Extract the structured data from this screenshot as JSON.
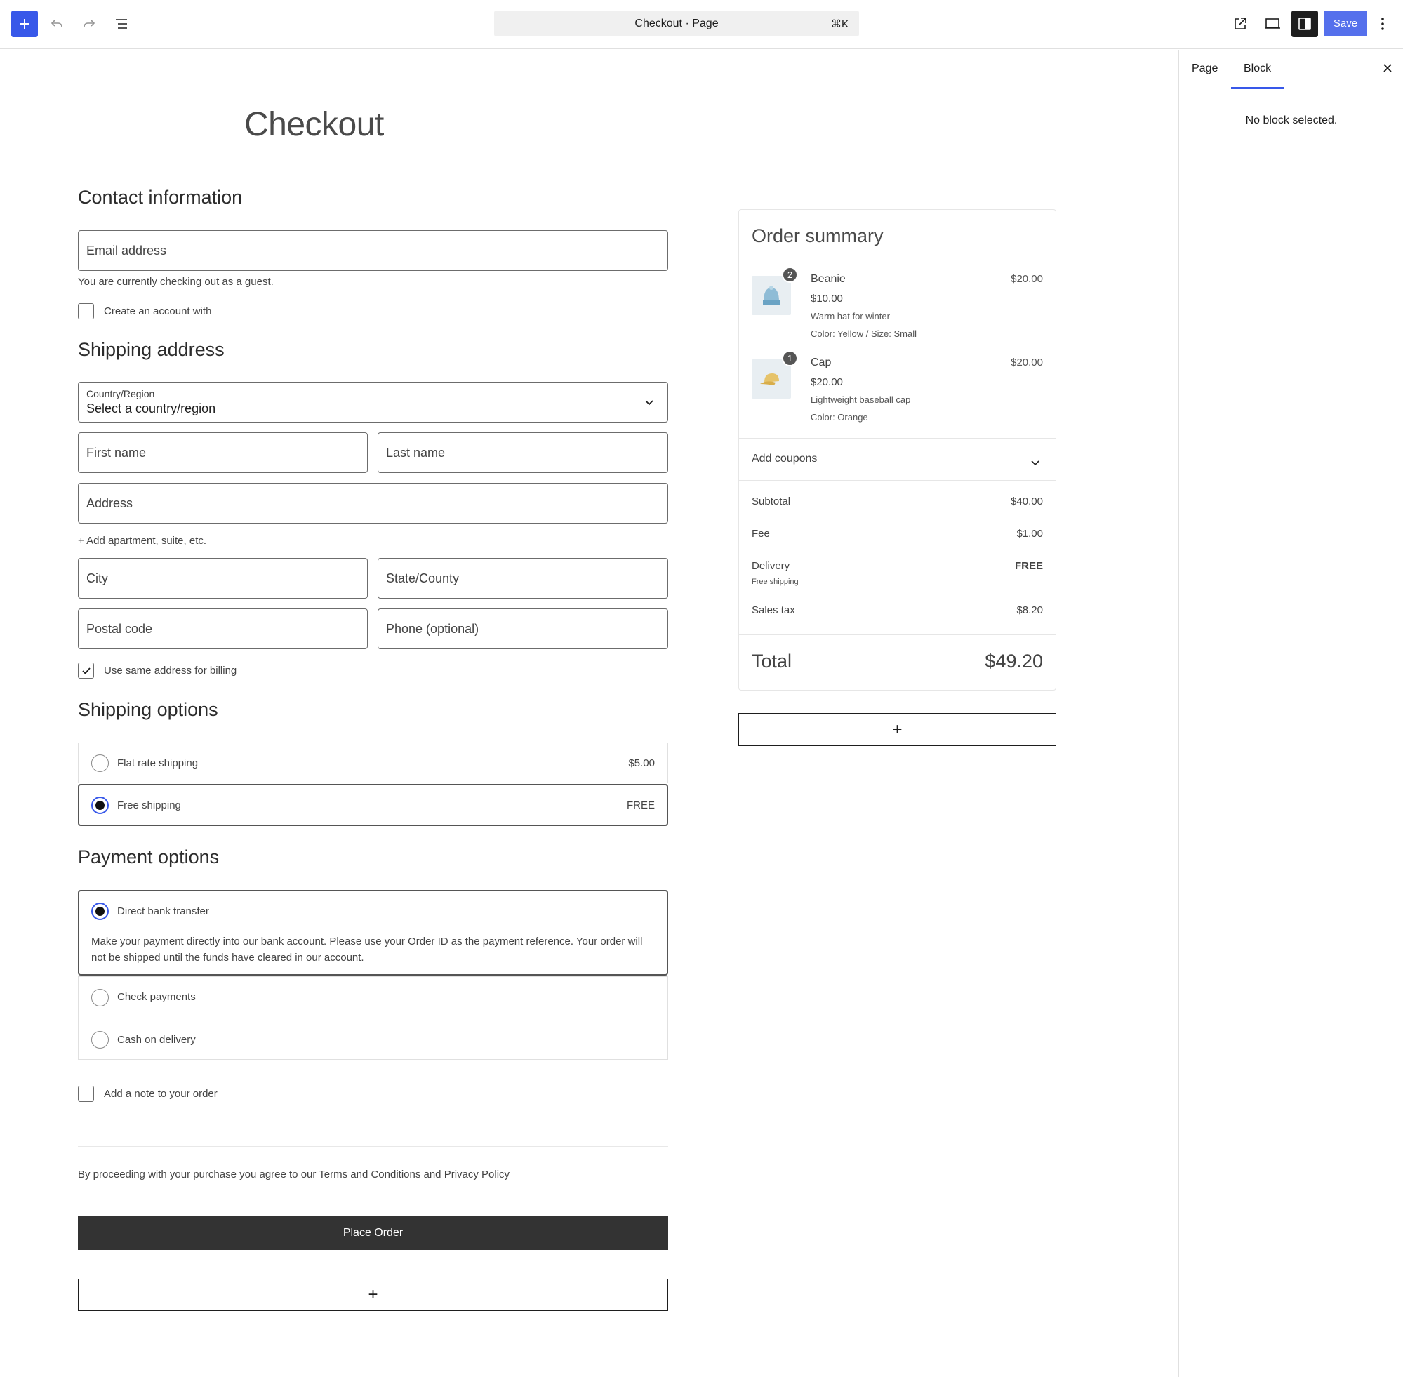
{
  "toolbar": {
    "command_title": "Checkout · Page",
    "command_shortcut": "⌘K",
    "save_label": "Save",
    "icons": [
      "plus-icon",
      "undo-icon",
      "redo-icon",
      "list-view-icon",
      "external-link-icon",
      "device-preview-icon",
      "sidebar-toggle-icon",
      "more-vertical-icon"
    ]
  },
  "sidebar": {
    "tabs": [
      "Page",
      "Block"
    ],
    "active_tab": "Block",
    "empty_message": "No block selected."
  },
  "page": {
    "title": "Checkout"
  },
  "contact": {
    "heading": "Contact information",
    "email_placeholder": "Email address",
    "guest_note": "You are currently checking out as a guest.",
    "create_account_label": "Create an account with",
    "create_account_checked": false
  },
  "shipping_address": {
    "heading": "Shipping address",
    "country_label": "Country/Region",
    "country_value": "Select a country/region",
    "first_name": "First name",
    "last_name": "Last name",
    "address": "Address",
    "add_apartment": "+ Add apartment, suite, etc.",
    "city": "City",
    "state": "State/County",
    "postal_code": "Postal code",
    "phone": "Phone (optional)",
    "same_billing_label": "Use same address for billing",
    "same_billing_checked": true
  },
  "shipping_options": {
    "heading": "Shipping options",
    "options": [
      {
        "label": "Flat rate shipping",
        "price": "$5.00",
        "selected": false
      },
      {
        "label": "Free shipping",
        "price": "FREE",
        "selected": true
      }
    ]
  },
  "payment_options": {
    "heading": "Payment options",
    "options": [
      {
        "label": "Direct bank transfer",
        "selected": true,
        "description": "Make your payment directly into our bank account. Please use your Order ID as the payment reference. Your order will not be shipped until the funds have cleared in our account."
      },
      {
        "label": "Check payments",
        "selected": false
      },
      {
        "label": "Cash on delivery",
        "selected": false
      }
    ]
  },
  "order_note": {
    "label": "Add a note to your order",
    "checked": false
  },
  "terms": "By proceeding with your purchase you agree to our Terms and Conditions and Privacy Policy",
  "place_order_label": "Place Order",
  "add_block_label": "+",
  "summary": {
    "title": "Order summary",
    "items": [
      {
        "qty": "2",
        "name": "Beanie",
        "price": "$10.00",
        "description": "Warm hat for winter",
        "variation": "Color: Yellow / Size: Small",
        "total": "$20.00",
        "image": "beanie-image"
      },
      {
        "qty": "1",
        "name": "Cap",
        "price": "$20.00",
        "description": "Lightweight baseball cap",
        "variation": "Color: Orange",
        "total": "$20.00",
        "image": "cap-image"
      }
    ],
    "coupons_label": "Add coupons",
    "subtotal_label": "Subtotal",
    "subtotal_value": "$40.00",
    "fee_label": "Fee",
    "fee_value": "$1.00",
    "delivery_label": "Delivery",
    "delivery_value": "FREE",
    "delivery_note": "Free shipping",
    "tax_label": "Sales tax",
    "tax_value": "$8.20",
    "total_label": "Total",
    "total_value": "$49.20"
  },
  "colors": {
    "accent": "#3858e9",
    "button_dark": "#333333"
  }
}
